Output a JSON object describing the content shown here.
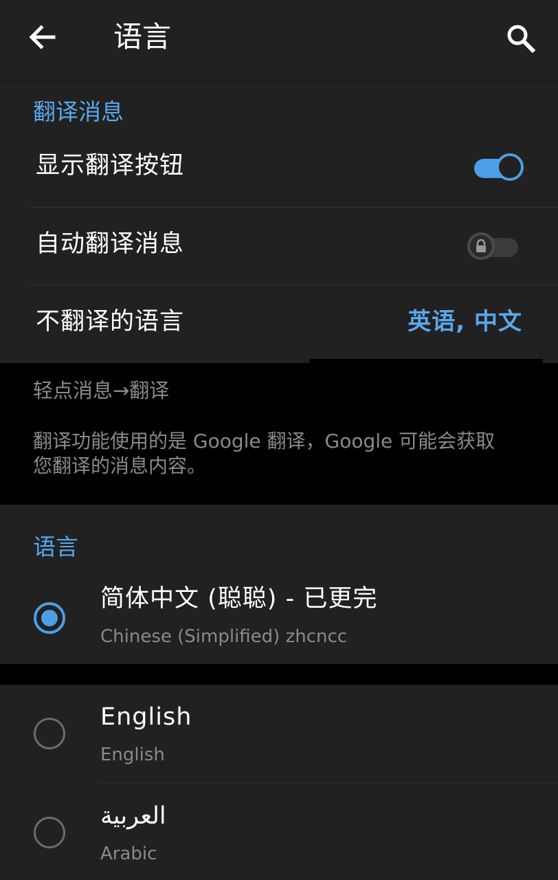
{
  "appbar": {
    "title": "语言",
    "back_icon": "arrow-left-icon",
    "search_icon": "search-icon"
  },
  "translate_section": {
    "header": "翻译消息",
    "show_button": {
      "label": "显示翻译按钮",
      "enabled": true
    },
    "auto_translate": {
      "label": "自动翻译消息",
      "enabled": false,
      "locked": true
    },
    "do_not_translate": {
      "label": "不翻译的语言",
      "value": "英语, 中文"
    }
  },
  "info": {
    "hint": "轻点消息→翻译",
    "privacy_line1": "翻译功能使用的是 Google 翻译，Google 可能会获取",
    "privacy_line2": "您翻译的消息内容。"
  },
  "language_section": {
    "header": "语言",
    "languages": [
      {
        "name": "简体中文 (聪聪) - 已更完",
        "subtitle": "Chinese (Simplified) zhcncc",
        "selected": true
      },
      {
        "name": "English",
        "subtitle": "English",
        "selected": false
      },
      {
        "name": "العربية",
        "subtitle": "Arabic",
        "selected": false
      }
    ]
  },
  "colors": {
    "accent": "#4a9fe6",
    "section_header": "#5aa7ec",
    "surface": "#212121",
    "background": "#000000",
    "secondary_text": "#8a8a8a"
  }
}
